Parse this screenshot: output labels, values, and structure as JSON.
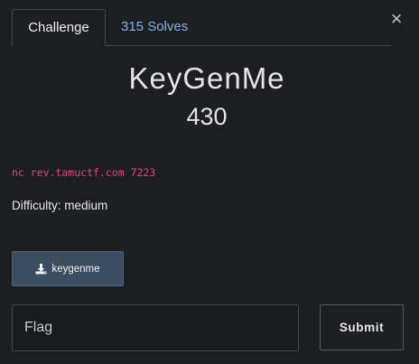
{
  "tabs": [
    {
      "label": "Challenge",
      "active": true
    },
    {
      "label": "315 Solves",
      "active": false
    }
  ],
  "close_icon": "close-icon",
  "challenge": {
    "name": "KeyGenMe",
    "points": "430",
    "connection": "nc rev.tamuctf.com 7223",
    "difficulty": "Difficulty: medium"
  },
  "files": [
    {
      "label": "keygenme",
      "icon": "download-icon"
    }
  ],
  "flag": {
    "placeholder": "Flag",
    "value": ""
  },
  "submit_label": "Submit",
  "colors": {
    "background": "#1d1e22",
    "link": "#7fb2e6",
    "code": "#e0457b",
    "file_button": "#3a4d61"
  }
}
